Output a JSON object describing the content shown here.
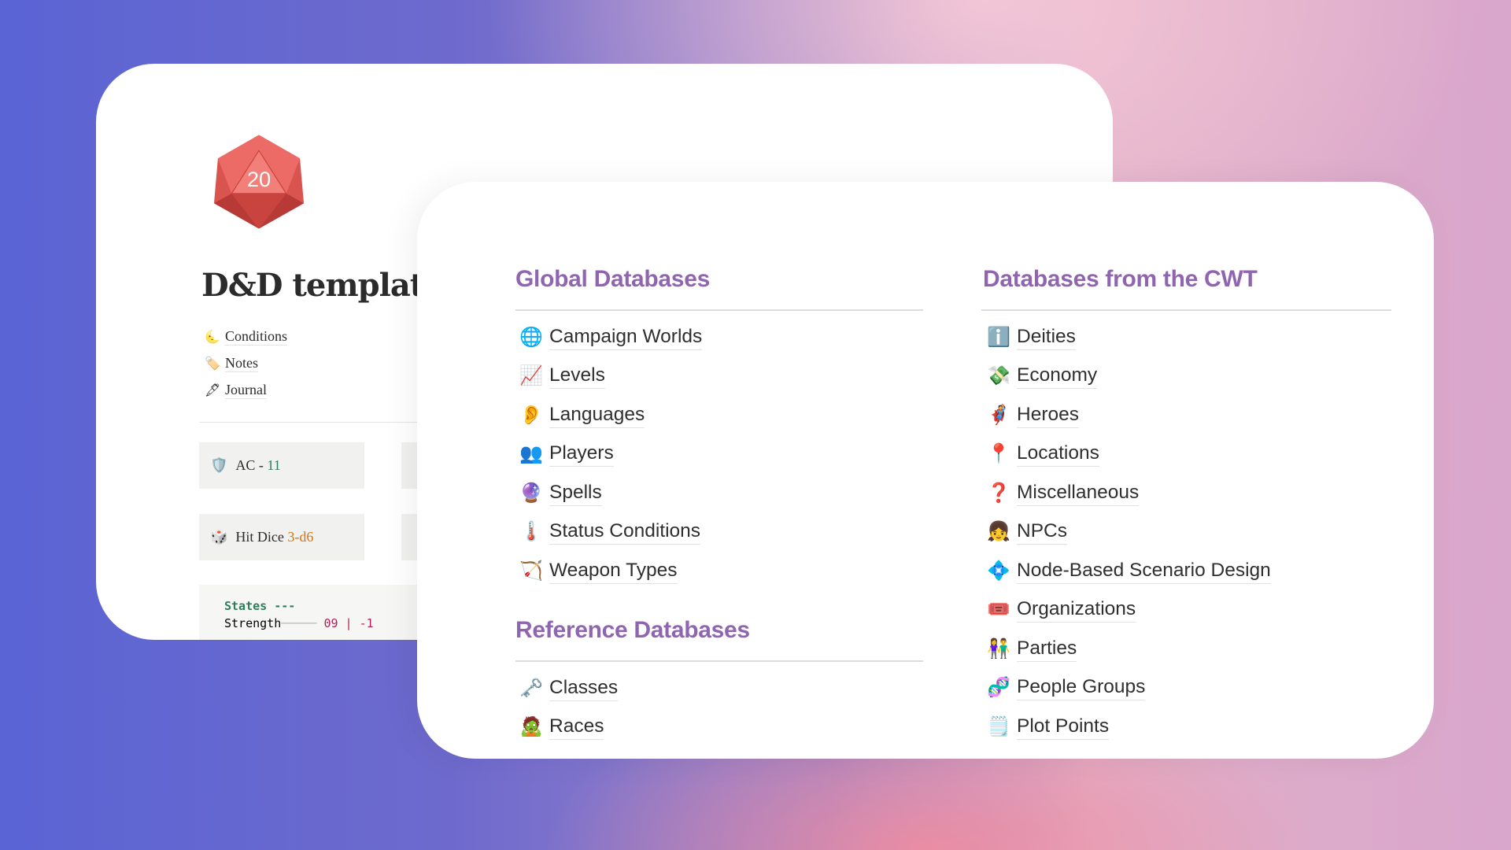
{
  "page": {
    "title": "D&D template",
    "d20_label": "20",
    "links": [
      {
        "icon": "🌜",
        "icon_name": "moon-icon",
        "label": "Conditions"
      },
      {
        "icon": "🏷️",
        "icon_name": "tag-icon",
        "label": "Notes"
      },
      {
        "icon": "🖋",
        "icon_name": "pen-icon",
        "label": "Journal"
      }
    ],
    "stats": [
      {
        "icon": "🛡️",
        "icon_name": "shield-icon",
        "label": "AC - ",
        "value": "11",
        "value_color": "#2e7d5b"
      },
      {
        "icon": "🎲",
        "icon_name": "dice-icon",
        "label": "Hit Dice ",
        "value": "3-d6",
        "value_color": "#d9730d"
      }
    ],
    "code": {
      "line1": "States ---",
      "line2_label": "Strength",
      "line2_value": "09 | -1"
    }
  },
  "global": {
    "heading": "Global Databases",
    "items": [
      {
        "icon": "🌐",
        "icon_name": "globe-icon",
        "label": "Campaign Worlds"
      },
      {
        "icon": "📈",
        "icon_name": "chart-increasing-icon",
        "label": "Levels"
      },
      {
        "icon": "👂",
        "icon_name": "ear-icon",
        "label": "Languages"
      },
      {
        "icon": "👥",
        "icon_name": "people-icon",
        "label": "Players"
      },
      {
        "icon": "🔮",
        "icon_name": "crystal-ball-icon",
        "label": "Spells"
      },
      {
        "icon": "🌡️",
        "icon_name": "thermometer-icon",
        "label": "Status Conditions"
      },
      {
        "icon": "🏹",
        "icon_name": "bow-and-arrow-icon",
        "label": "Weapon Types"
      }
    ]
  },
  "reference": {
    "heading": "Reference Databases",
    "items": [
      {
        "icon": "🗝️",
        "icon_name": "key-icon",
        "label": "Classes"
      },
      {
        "icon": "🧟",
        "icon_name": "zombie-icon",
        "label": "Races"
      }
    ]
  },
  "cwt": {
    "heading": "Databases from the CWT",
    "items": [
      {
        "icon": "ℹ️",
        "icon_name": "info-icon",
        "label": "Deities"
      },
      {
        "icon": "💸",
        "icon_name": "money-wings-icon",
        "label": "Economy"
      },
      {
        "icon": "🦸",
        "icon_name": "superhero-icon",
        "label": "Heroes"
      },
      {
        "icon": "📍",
        "icon_name": "pin-icon",
        "label": "Locations"
      },
      {
        "icon": "❓",
        "icon_name": "question-icon",
        "label": "Miscellaneous"
      },
      {
        "icon": "👧",
        "icon_name": "girl-icon",
        "label": "NPCs"
      },
      {
        "icon": "💠",
        "icon_name": "diamond-icon",
        "label": "Node-Based Scenario Design"
      },
      {
        "icon": "🎟️",
        "icon_name": "ticket-icon",
        "label": "Organizations"
      },
      {
        "icon": "👫",
        "icon_name": "couple-icon",
        "label": "Parties"
      },
      {
        "icon": "🧬",
        "icon_name": "dna-icon",
        "label": "People Groups"
      },
      {
        "icon": "🗒️",
        "icon_name": "notepad-icon",
        "label": "Plot Points"
      }
    ]
  },
  "colors": {
    "heading": "#9065b0",
    "d20": "#e05a5a"
  }
}
